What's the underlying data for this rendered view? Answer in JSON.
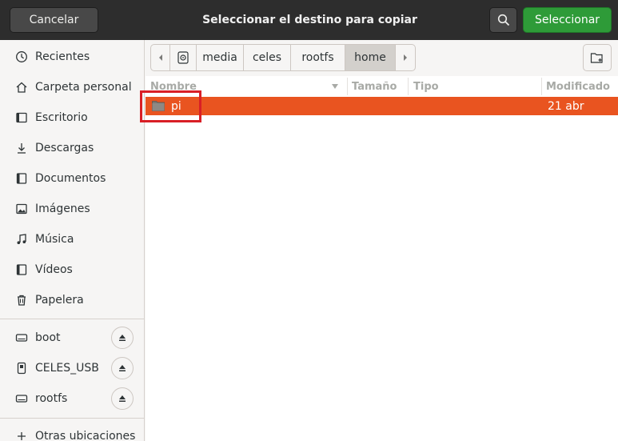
{
  "header": {
    "cancel_label": "Cancelar",
    "title": "Seleccionar el destino para copiar",
    "select_label": "Seleccionar"
  },
  "sidebar": {
    "places": [
      {
        "label": "Recientes",
        "icon": "clock-icon"
      },
      {
        "label": "Carpeta personal",
        "icon": "home-icon"
      },
      {
        "label": "Escritorio",
        "icon": "desktop-icon"
      },
      {
        "label": "Descargas",
        "icon": "download-icon"
      },
      {
        "label": "Documentos",
        "icon": "document-icon"
      },
      {
        "label": "Imágenes",
        "icon": "image-icon"
      },
      {
        "label": "Música",
        "icon": "music-icon"
      },
      {
        "label": "Vídeos",
        "icon": "video-icon"
      },
      {
        "label": "Papelera",
        "icon": "trash-icon"
      }
    ],
    "devices": [
      {
        "label": "boot",
        "icon": "drive-icon"
      },
      {
        "label": "CELES_USB",
        "icon": "usb-icon"
      },
      {
        "label": "rootfs",
        "icon": "drive-icon"
      }
    ],
    "other_label": "Otras ubicaciones"
  },
  "pathbar": {
    "segments": [
      "media",
      "celes",
      "rootfs",
      "home"
    ],
    "active": "home"
  },
  "filelist": {
    "columns": {
      "name": "Nombre",
      "size": "Tamaño",
      "type": "Tipo",
      "modified": "Modificado"
    },
    "rows": [
      {
        "name": "pi",
        "size": "",
        "type": "",
        "modified": "21 abr",
        "selected": true,
        "icon": "folder-icon"
      }
    ]
  },
  "colors": {
    "selection": "#e95420",
    "select_button": "#2e9b38",
    "headerbar": "#2d2d2d",
    "annotation_box": "#d91f26"
  }
}
